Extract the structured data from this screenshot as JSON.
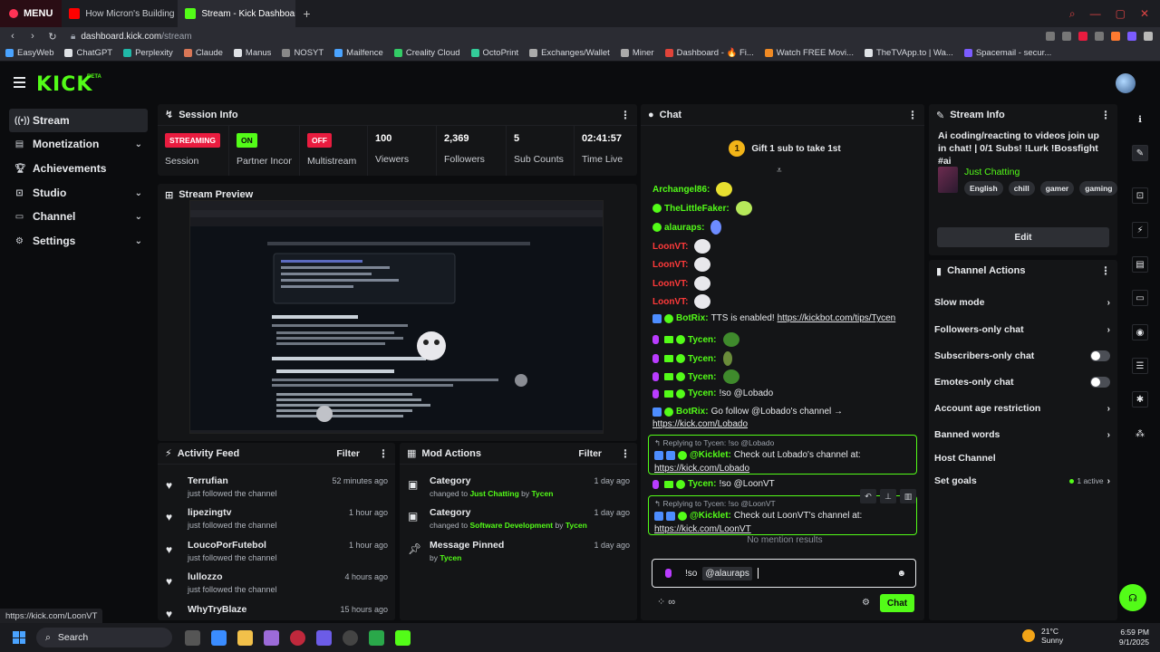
{
  "browser": {
    "menu_label": "MENU",
    "tabs": [
      {
        "title": "How Micron's Building Bi",
        "active": false
      },
      {
        "title": "Stream - Kick Dashboard",
        "active": true
      }
    ],
    "url_host": "dashboard.kick.com",
    "url_path": "/stream",
    "bookmarks": [
      "EasyWeb",
      "ChatGPT",
      "Perplexity",
      "Claude",
      "Manus",
      "NOSYT",
      "Mailfence",
      "Creality Cloud",
      "OctoPrint",
      "Exchanges/Wallet",
      "Miner",
      "Dashboard - 🔥 Fi...",
      "Watch FREE Movi...",
      "TheTVApp.to | Wa...",
      "Spacemail - secur..."
    ]
  },
  "brand": {
    "logo": "KICK",
    "beta": "BETA",
    "accent": "#53fc18"
  },
  "sidebar": {
    "items": [
      {
        "label": "Stream",
        "icon": "broadcast-icon",
        "active": true,
        "chevron": false
      },
      {
        "label": "Monetization",
        "icon": "money-icon",
        "chevron": true
      },
      {
        "label": "Achievements",
        "icon": "trophy-icon",
        "chevron": false
      },
      {
        "label": "Studio",
        "icon": "studio-icon",
        "chevron": true
      },
      {
        "label": "Channel",
        "icon": "channel-icon",
        "chevron": true
      },
      {
        "label": "Settings",
        "icon": "gear-icon",
        "chevron": true
      }
    ]
  },
  "session": {
    "title": "Session Info",
    "cells": [
      {
        "badge": "STREAMING",
        "badge_color": "red",
        "label": "Session"
      },
      {
        "badge": "ON",
        "badge_color": "green",
        "label": "Partner Income"
      },
      {
        "badge": "OFF",
        "badge_color": "red",
        "label": "Multistream"
      },
      {
        "value": "100",
        "label": "Viewers"
      },
      {
        "value": "2,369",
        "label": "Followers"
      },
      {
        "value": "5",
        "label": "Sub Counts"
      },
      {
        "value": "02:41:57",
        "label": "Time Live"
      }
    ]
  },
  "preview": {
    "title": "Stream Preview"
  },
  "activity": {
    "title": "Activity Feed",
    "filter": "Filter",
    "items": [
      {
        "user": "Terrufian",
        "action": "just followed the channel",
        "time": "52 minutes ago"
      },
      {
        "user": "lipezingtv",
        "action": "just followed the channel",
        "time": "1 hour ago"
      },
      {
        "user": "LoucoPorFutebol",
        "action": "just followed the channel",
        "time": "1 hour ago"
      },
      {
        "user": "lullozzo",
        "action": "just followed the channel",
        "time": "4 hours ago"
      },
      {
        "user": "WhyTryBlaze",
        "action": "",
        "time": "15 hours ago"
      }
    ]
  },
  "mod_actions": {
    "title": "Mod Actions",
    "filter": "Filter",
    "items": [
      {
        "title": "Category",
        "pre": "changed to",
        "target": "Just Chatting",
        "by_word": "by",
        "by": "Tycen",
        "time": "1 day ago"
      },
      {
        "title": "Category",
        "pre": "changed to",
        "target": "Software Development",
        "by_word": "by",
        "by": "Tycen",
        "time": "1 day ago"
      },
      {
        "title": "Message Pinned",
        "pre": "",
        "target": "",
        "by_word": "by",
        "by": "Tycen",
        "time": "1 day ago"
      }
    ]
  },
  "chat": {
    "title": "Chat",
    "gift_count": "1",
    "gift_text": "Gift 1 sub to take 1st",
    "messages": [
      {
        "user": "Archangel86:",
        "color": "green",
        "text": ""
      },
      {
        "user": "TheLittleFaker:",
        "color": "green",
        "text": ""
      },
      {
        "user": "alauraps:",
        "color": "green",
        "text": ""
      },
      {
        "user": "LoonVT:",
        "color": "red",
        "text": ""
      },
      {
        "user": "LoonVT:",
        "color": "red",
        "text": ""
      },
      {
        "user": "LoonVT:",
        "color": "red",
        "text": ""
      },
      {
        "user": "LoonVT:",
        "color": "red",
        "text": ""
      },
      {
        "user": "BotRix:",
        "color": "green",
        "text": "TTS is enabled!",
        "link": "https://kickbot.com/tips/Tycen"
      },
      {
        "user": "Tycen:",
        "color": "green",
        "text": ""
      },
      {
        "user": "Tycen:",
        "color": "green",
        "text": ""
      },
      {
        "user": "Tycen:",
        "color": "green",
        "text": ""
      },
      {
        "user": "Tycen:",
        "color": "green",
        "text": "!so @Lobado"
      },
      {
        "user": "BotRix:",
        "color": "green",
        "text": "Go follow @Lobado's channel →",
        "link": "https://kick.com/Lobado"
      },
      {
        "user": "Tycen:",
        "color": "green",
        "text": "!so @LoonVT"
      }
    ],
    "replies": [
      {
        "replying": "Replying to Tycen: !so @Lobado",
        "user": "@Kicklet:",
        "text": "Check out Lobado's channel at:",
        "link": "https://kick.com/Lobado"
      },
      {
        "replying": "Replying to Tycen: !so @LoonVT",
        "user": "@Kicklet:",
        "text": "Check out LoonVT's channel at:",
        "link": "https://kick.com/LoonVT"
      }
    ],
    "no_mention": "No mention results",
    "input_cmd": "!so",
    "input_mention": "@alauraps",
    "send_label": "Chat"
  },
  "stream_info": {
    "title": "Stream Info",
    "text": "Ai coding/reacting to videos join up in chat! | 0/1 Subs! !Lurk !Bossfight #ai",
    "category": "Just Chatting",
    "tags": [
      "English",
      "chill",
      "gamer",
      "gaming"
    ],
    "edit_label": "Edit"
  },
  "channel_actions": {
    "title": "Channel Actions",
    "rows": [
      {
        "label": "Slow mode",
        "kind": "chevron"
      },
      {
        "label": "Followers-only chat",
        "kind": "chevron"
      },
      {
        "label": "Subscribers-only chat",
        "kind": "toggle"
      },
      {
        "label": "Emotes-only chat",
        "kind": "toggle"
      },
      {
        "label": "Account age restriction",
        "kind": "chevron"
      },
      {
        "label": "Banned words",
        "kind": "chevron"
      },
      {
        "label": "Host Channel",
        "kind": "none"
      },
      {
        "label": "Set goals",
        "kind": "active",
        "note": "1 active"
      }
    ]
  },
  "status_url": "https://kick.com/LoonVT",
  "taskbar": {
    "search": "Search",
    "temp": "21°C",
    "weather": "Sunny",
    "time": "6:59 PM",
    "date": "9/1/2025"
  }
}
